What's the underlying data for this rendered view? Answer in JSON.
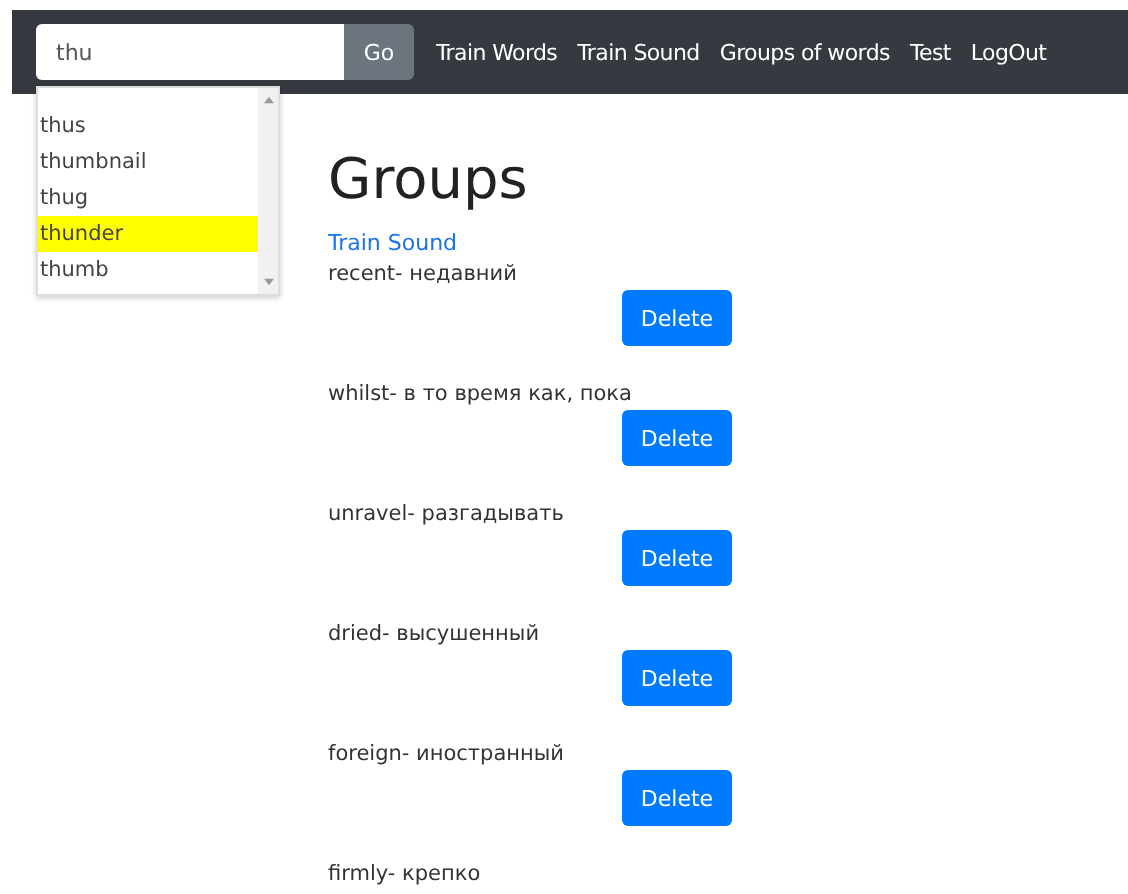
{
  "search": {
    "value": "thu",
    "button": "Go"
  },
  "nav": [
    "Train Words",
    "Train Sound",
    "Groups of words",
    "Test",
    "LogOut"
  ],
  "suggestions": [
    {
      "text": "thus",
      "selected": false
    },
    {
      "text": "thumbnail",
      "selected": false
    },
    {
      "text": "thug",
      "selected": false
    },
    {
      "text": "thunder",
      "selected": true
    },
    {
      "text": "thumb",
      "selected": false
    }
  ],
  "heading": "Groups",
  "link": "Train Sound",
  "words": [
    {
      "text": "recent- недавний",
      "button": "Delete"
    },
    {
      "text": "whilst- в то время как, пока",
      "button": "Delete"
    },
    {
      "text": "unravel- разгадывать",
      "button": "Delete"
    },
    {
      "text": "dried- высушенный",
      "button": "Delete"
    },
    {
      "text": "foreign- иностранный",
      "button": "Delete"
    },
    {
      "text": "firmly- крепко"
    }
  ]
}
